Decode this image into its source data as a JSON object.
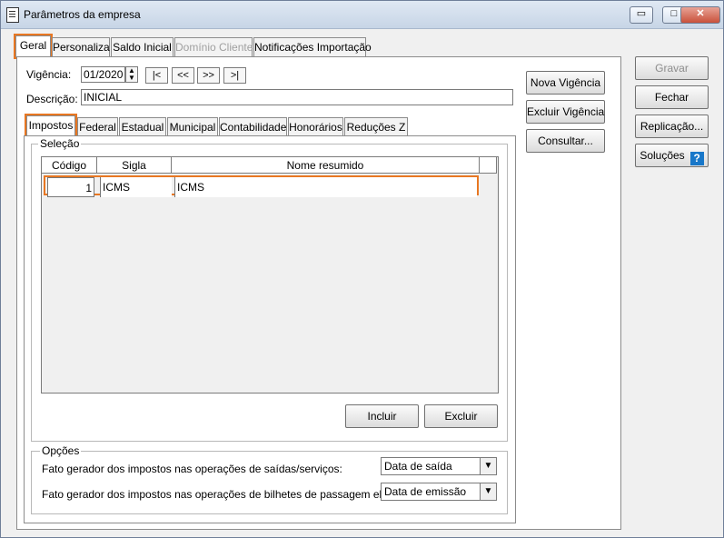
{
  "window": {
    "title": "Parâmetros da empresa",
    "minimize": "▭",
    "maximize": "□",
    "close": "✕"
  },
  "main_tabs": [
    "Geral",
    "Personaliza",
    "Saldo Inicial",
    "Domínio Cliente",
    "Notificações Importação"
  ],
  "form": {
    "vigencia_label": "Vigência:",
    "vigencia_value": "01/2020",
    "descricao_label": "Descrição:",
    "descricao_value": "INICIAL",
    "nav_first": "|<",
    "nav_prev": "<<",
    "nav_next": ">>",
    "nav_last": ">|"
  },
  "sub_tabs": [
    "Impostos",
    "Federal",
    "Estadual",
    "Municipal",
    "Contabilidade",
    "Honorários",
    "Reduções Z"
  ],
  "selection": {
    "legend": "Seleção",
    "columns": [
      "Código",
      "Sigla",
      "Nome resumido"
    ],
    "rows": [
      {
        "codigo": "1",
        "sigla": "ICMS",
        "nome": "ICMS"
      }
    ],
    "include_button": "Incluir",
    "delete_button": "Excluir"
  },
  "options": {
    "legend": "Opções",
    "option1_label": "Fato gerador dos impostos nas operações de saídas/serviços:",
    "option1_value": "Data de saída",
    "option2_label": "Fato gerador dos impostos nas operações de bilhetes de passagem eletrônico:",
    "option2_value": "Data de emissão"
  },
  "side_buttons": {
    "nova_vigencia": "Nova Vigência",
    "excluir_vigencia": "Excluir Vigência",
    "consultar": "Consultar..."
  },
  "right_buttons": {
    "gravar": "Gravar",
    "fechar": "Fechar",
    "replicacao": "Replicação...",
    "solucoes": "Soluções",
    "help_icon": "?"
  },
  "colors": {
    "highlight": "#e87722",
    "help": "#1877c9"
  }
}
